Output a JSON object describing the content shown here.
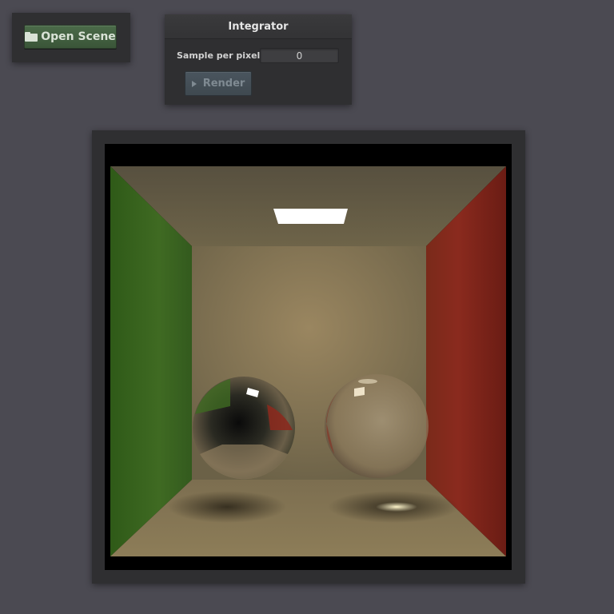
{
  "toolbar": {
    "open_scene_label": "Open Scene",
    "open_scene_icon": "folder-icon"
  },
  "integrator": {
    "title": "Integrator",
    "spp_label": "Sample per pixel:",
    "spp_value": "0",
    "render_label": "Render",
    "render_icon": "play-icon"
  },
  "colors": {
    "background": "#4b4a52",
    "panel": "#2f2f31",
    "open_button": "#4b6b49",
    "render_button": "#4a555e",
    "left_wall": "#3f6a22",
    "right_wall": "#8a2a1e",
    "back_wall": "#8c7a5c"
  },
  "viewport": {
    "scene": "cornell-box-render"
  }
}
